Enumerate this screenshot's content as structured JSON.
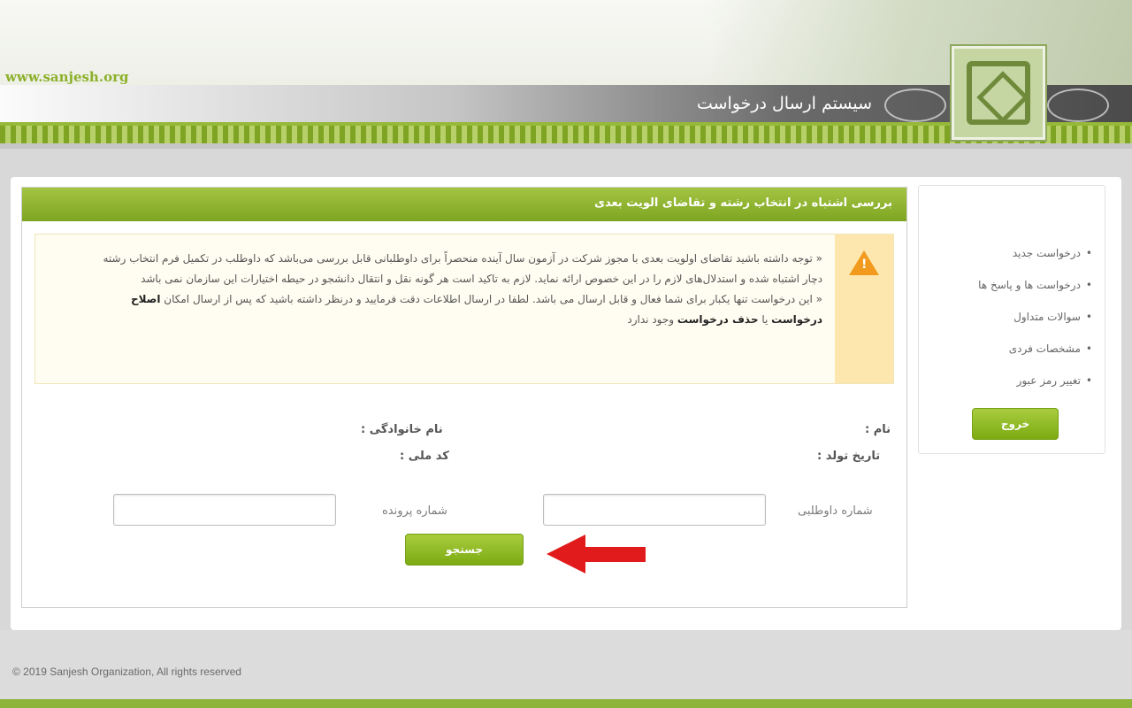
{
  "header": {
    "site_url": "www.sanjesh.org",
    "system_title": "سیستم ارسال درخواست"
  },
  "panel": {
    "title": "بررسی اشتباه در انتخاب رشته و تقاضای الویت بعدی",
    "notice": {
      "icon": "warning-icon",
      "line1": "توجه داشته باشید تقاضای اولویت بعدی با مجوز شرکت در آزمون سال آینده منحصراً برای داوطلبانی قابل بررسی می‌باشد که داوطلب در تکمیل فرم انتخاب رشته دچار اشتباه شده و استدلال‌های لازم را در این خصوص ارائه نماید. لازم به تاکید است هر گونه نقل و انتقال دانشجو در حیطه اختیارات این سازمان نمی باشد",
      "line2_part1": "این درخواست تنها یکبار برای شما فعال و قابل ارسال می باشد. لطفا در ارسال اطلاعات دقت فرمایید و درنظر داشته باشید که پس از ارسال امکان",
      "line2_bold1": "اصلاح درخواست",
      "line2_mid": "یا",
      "line2_bold2": "حذف درخواست",
      "line2_end": "وجود ندارد"
    },
    "info": {
      "name_label": "نام :",
      "family_label": "نام خانوادگی :",
      "birth_label": "تاریخ تولد :",
      "national_code_label": "کد ملی :"
    },
    "form": {
      "candidate_number_label": "شماره داوطلبی",
      "case_number_label": "شماره پرونده",
      "candidate_number_value": "",
      "case_number_value": "",
      "search_button": "جستجو"
    }
  },
  "sidebar": {
    "items": [
      {
        "label": "درخواست جدید"
      },
      {
        "label": "درخواست ها و پاسخ ها"
      },
      {
        "label": "سوالات متداول"
      },
      {
        "label": "مشخصات فردی"
      },
      {
        "label": "تغییر رمز عبور"
      }
    ],
    "logout_button": "خروج"
  },
  "footer": {
    "copyright": "© 2019 Sanjesh Organization, All rights reserved"
  },
  "colors": {
    "brand_green": "#8cb02a",
    "button_green": "#7cab12",
    "arrow_red": "#e11b1b",
    "warning_orange": "#f29a1d"
  }
}
